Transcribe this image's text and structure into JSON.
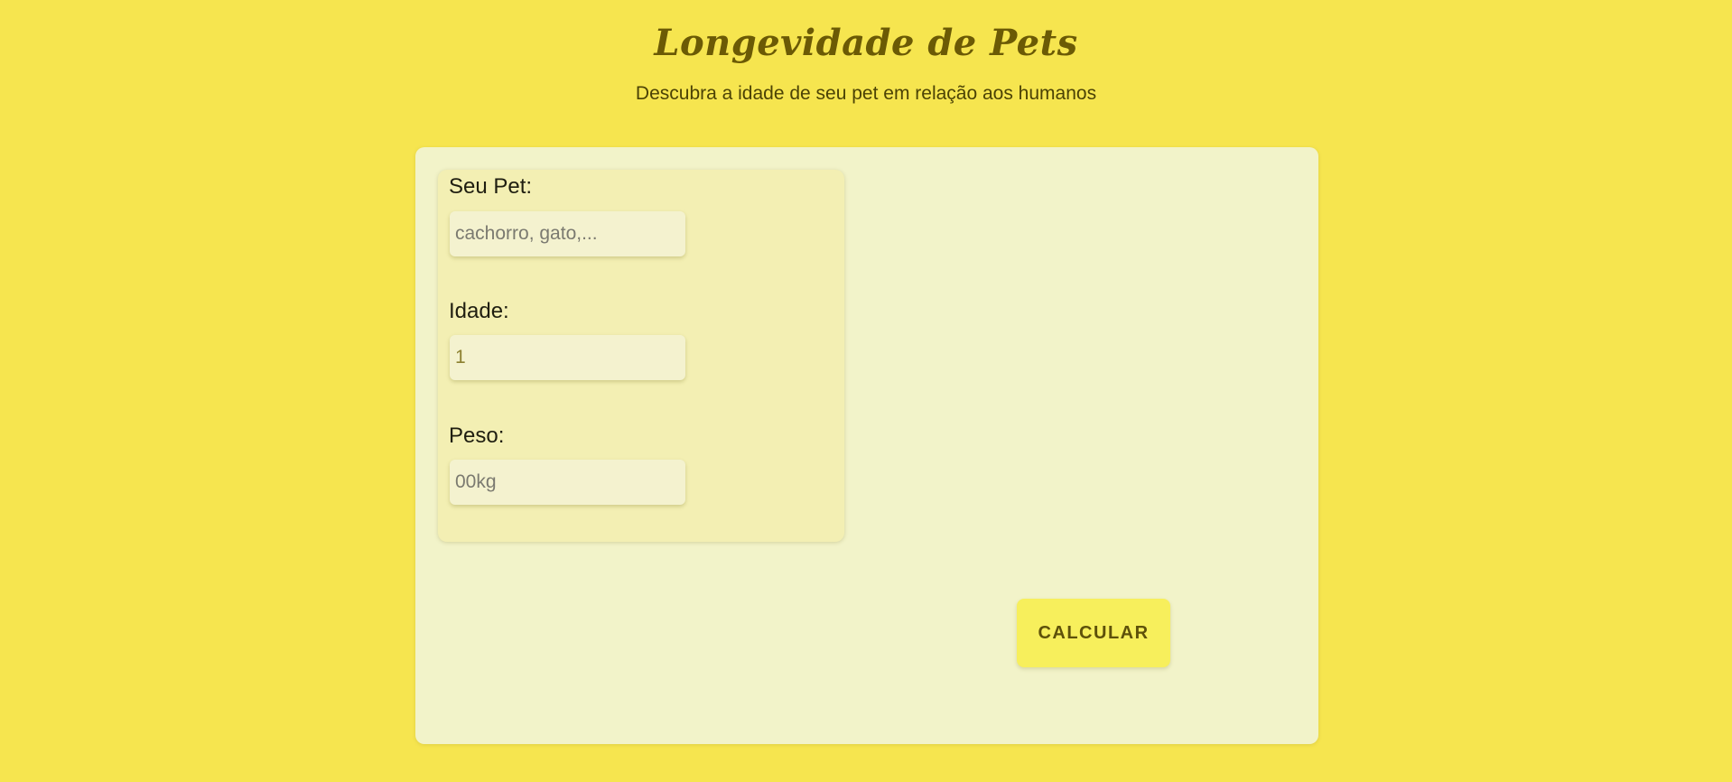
{
  "header": {
    "title": "Longevidade de Pets",
    "subtitle": "Descubra a idade de seu pet em relação aos humanos"
  },
  "form": {
    "pet": {
      "label": "Seu Pet:",
      "placeholder": "cachorro, gato,..."
    },
    "idade": {
      "label": "Idade:",
      "value": "1"
    },
    "peso": {
      "label": "Peso:",
      "placeholder": "00kg"
    }
  },
  "actions": {
    "calculate_label": "CALCULAR"
  },
  "colors": {
    "page_background": "#f6e54f",
    "card_background": "#f2f3c9",
    "title_color": "#6b5a05",
    "button_background": "#f7ef5c"
  }
}
